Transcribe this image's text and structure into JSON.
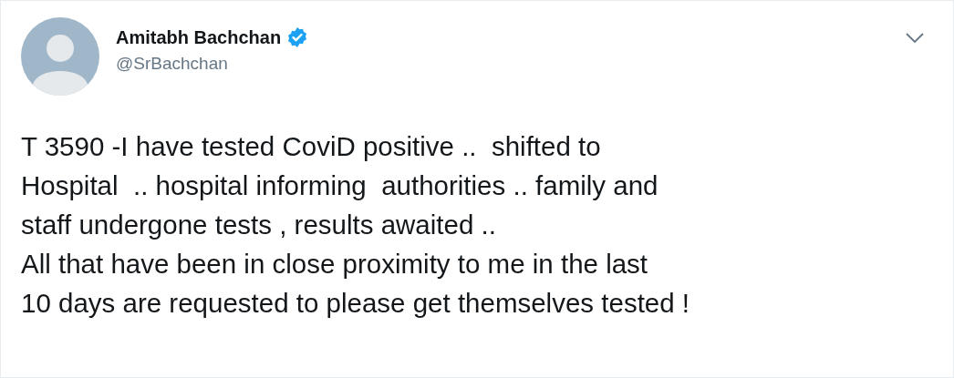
{
  "author": {
    "name": "Amitabh Bachchan",
    "verified": true,
    "handle": "@SrBachchan"
  },
  "tweet_lines": [
    "T 3590 -I have tested CoviD positive ..  shifted to",
    "Hospital  .. hospital informing  authorities .. family and",
    "staff undergone tests , results awaited ..",
    "All that have been in close proximity to me in the last",
    "10 days are requested to please get themselves tested !"
  ]
}
